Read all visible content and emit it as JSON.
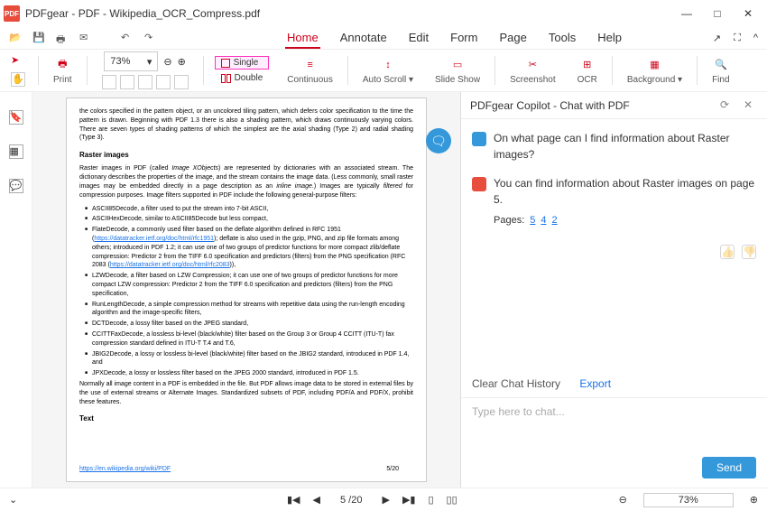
{
  "window": {
    "app": "PDFgear",
    "sep": " - PDF - ",
    "file": "Wikipedia_OCR_Compress.pdf"
  },
  "tabs": {
    "home": "Home",
    "annotate": "Annotate",
    "edit": "Edit",
    "form": "Form",
    "page": "Page",
    "tools": "Tools",
    "help": "Help"
  },
  "ribbon": {
    "print": "Print",
    "zoom": "73%",
    "single": "Single",
    "double": "Double",
    "continuous": "Continuous",
    "autoscroll": "Auto Scroll",
    "slideshow": "Slide Show",
    "screenshot": "Screenshot",
    "ocr": "OCR",
    "background": "Background",
    "find": "Find"
  },
  "doc": {
    "p1": "the colors specified in the pattern object, or an uncolored tiling pattern, which defers color specification to the time the pattern is drawn. Beginning with PDF 1.3 there is also a shading pattern, which draws continuously varying colors. There are seven types of shading patterns of which the simplest are the axial shading (Type 2) and radial shading (Type 3).",
    "h1": "Raster images",
    "p2a": "Raster images in PDF (called ",
    "p2b": "Image XObjects",
    "p2c": ") are represented by dictionaries with an associated stream. The dictionary describes the properties of the image, and the stream contains the image data. (Less commonly, small raster images may be embedded directly in a page description as an ",
    "p2d": "inline image",
    "p2e": ".) Images are typically ",
    "p2f": "filtered",
    "p2g": " for compression purposes. Image filters supported in PDF include the following general-purpose filters:",
    "li1": "ASCII85Decode, a filter used to put the stream into 7-bit ASCII,",
    "li2": "ASCIIHexDecode, similar to ASCII85Decode but less compact,",
    "li3a": "FlateDecode, a commonly used filter based on the deflate algorithm defined in RFC 1951 (",
    "li3link1": "https://datatracker.ietf.org/doc/html/rfc1951",
    "li3b": "); deflate is also used in the gzip, PNG, and zip file formats among others; introduced in PDF 1.2; it can use one of two groups of predictor functions for more compact zlib/deflate compression: Predictor 2 from the TIFF 6.0 specification and predictors (filters) from the PNG specification (RFC 2083 (",
    "li3link2": "https://datatracker.ietf.org/doc/html/rfc2083",
    "li3c": ")),",
    "li4": "LZWDecode, a filter based on LZW Compression; it can use one of two groups of predictor functions for more compact LZW compression: Predictor 2 from the TIFF 6.0 specification and predictors (filters) from the PNG specification,",
    "li5": "RunLengthDecode, a simple compression method for streams with repetitive data using the run-length encoding algorithm and the image-specific filters,",
    "li6": "DCTDecode, a lossy filter based on the JPEG standard,",
    "li7": "CCITTFaxDecode, a lossless bi-level (black/white) filter based on the Group 3 or Group 4 CCITT (ITU-T) fax compression standard defined in ITU-T T.4 and T.6,",
    "li8": "JBIG2Decode, a lossy or lossless bi-level (black/white) filter based on the JBIG2 standard, introduced in PDF 1.4, and",
    "li9": "JPXDecode, a lossy or lossless filter based on the JPEG 2000 standard, introduced in PDF 1.5.",
    "p3": "Normally all image content in a PDF is embedded in the file. But PDF allows image data to be stored in external files by the use of external streams or Alternate Images. Standardized subsets of PDF, including PDF/A and PDF/X, prohibit these features.",
    "h2": "Text",
    "footer": "https://en.wikipedia.org/wiki/PDF",
    "pagenum": "5/20"
  },
  "chat": {
    "title": "PDFgear Copilot - Chat with PDF",
    "q": "On what page can I find information about Raster images?",
    "a": "You can find information about Raster images on page 5.",
    "pages_lbl": "Pages:",
    "pg1": "5",
    "pg2": "4",
    "pg3": "2",
    "clear": "Clear Chat History",
    "export": "Export",
    "placeholder": "Type here to chat...",
    "send": "Send"
  },
  "status": {
    "page": "5",
    "total": "/20",
    "zoom": "73%"
  }
}
